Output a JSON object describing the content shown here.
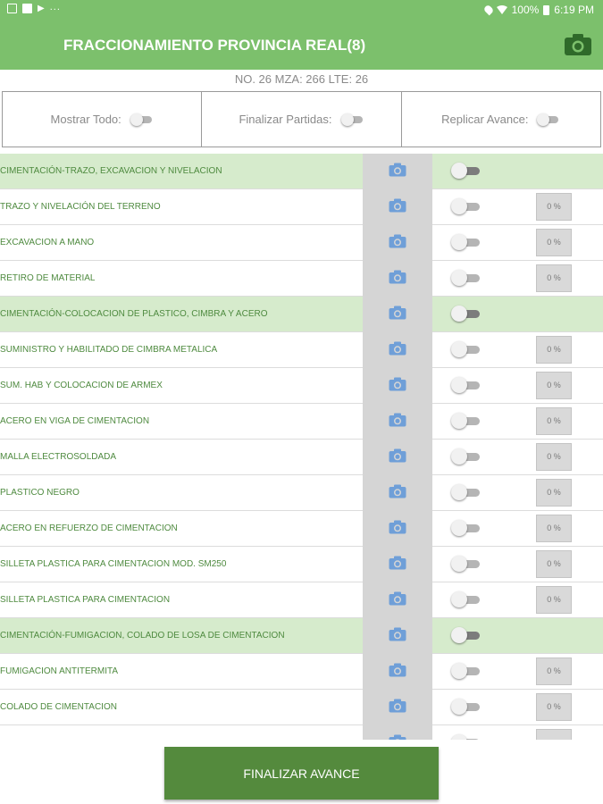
{
  "status_bar": {
    "battery": "100%",
    "time": "6:19 PM",
    "dots": "..."
  },
  "app_bar": {
    "title": "FRACCIONAMIENTO PROVINCIA REAL(8)"
  },
  "subtitle": "NO. 26 MZA: 266 LTE: 26",
  "options": {
    "show_all": "Mostrar Todo:",
    "finalize_items": "Finalizar Partidas:",
    "replicate_progress": "Replicar Avance:"
  },
  "rows": [
    {
      "label": "CIMENTACIÓN-TRAZO, EXCAVACION Y NIVELACION",
      "group": true
    },
    {
      "label": "TRAZO Y NIVELACIÓN DEL TERRENO",
      "group": false,
      "percent": "0 %"
    },
    {
      "label": "EXCAVACION A MANO",
      "group": false,
      "percent": "0 %"
    },
    {
      "label": "RETIRO DE MATERIAL",
      "group": false,
      "percent": "0 %"
    },
    {
      "label": "CIMENTACIÓN-COLOCACION DE PLASTICO, CIMBRA Y ACERO",
      "group": true
    },
    {
      "label": "SUMINISTRO Y HABILITADO DE CIMBRA METALICA",
      "group": false,
      "percent": "0 %"
    },
    {
      "label": "SUM. HAB Y COLOCACION DE ARMEX",
      "group": false,
      "percent": "0 %"
    },
    {
      "label": "ACERO EN VIGA DE CIMENTACION",
      "group": false,
      "percent": "0 %"
    },
    {
      "label": "MALLA ELECTROSOLDADA",
      "group": false,
      "percent": "0 %"
    },
    {
      "label": "PLASTICO NEGRO",
      "group": false,
      "percent": "0 %"
    },
    {
      "label": "ACERO EN REFUERZO DE CIMENTACION",
      "group": false,
      "percent": "0 %"
    },
    {
      "label": "SILLETA PLASTICA PARA CIMENTACION MOD. SM250",
      "group": false,
      "percent": "0 %"
    },
    {
      "label": "SILLETA PLASTICA PARA CIMENTACION",
      "group": false,
      "percent": "0 %"
    },
    {
      "label": "CIMENTACIÓN-FUMIGACION, COLADO DE LOSA DE CIMENTACION",
      "group": true
    },
    {
      "label": "FUMIGACION ANTITERMITA",
      "group": false,
      "percent": "0 %"
    },
    {
      "label": "COLADO DE CIMENTACION",
      "group": false,
      "percent": "0 %"
    },
    {
      "label": "",
      "group": false,
      "percent": ""
    }
  ],
  "footer": {
    "finalize_button": "FINALIZAR AVANCE"
  },
  "colors": {
    "primary": "#7cc06c",
    "group_row": "#d6ebcc",
    "button": "#548a3d",
    "camera_icon": "#6f9fd8"
  },
  "icons": {
    "row_photo": "camera-icon",
    "app_bar_action": "camera-icon"
  }
}
